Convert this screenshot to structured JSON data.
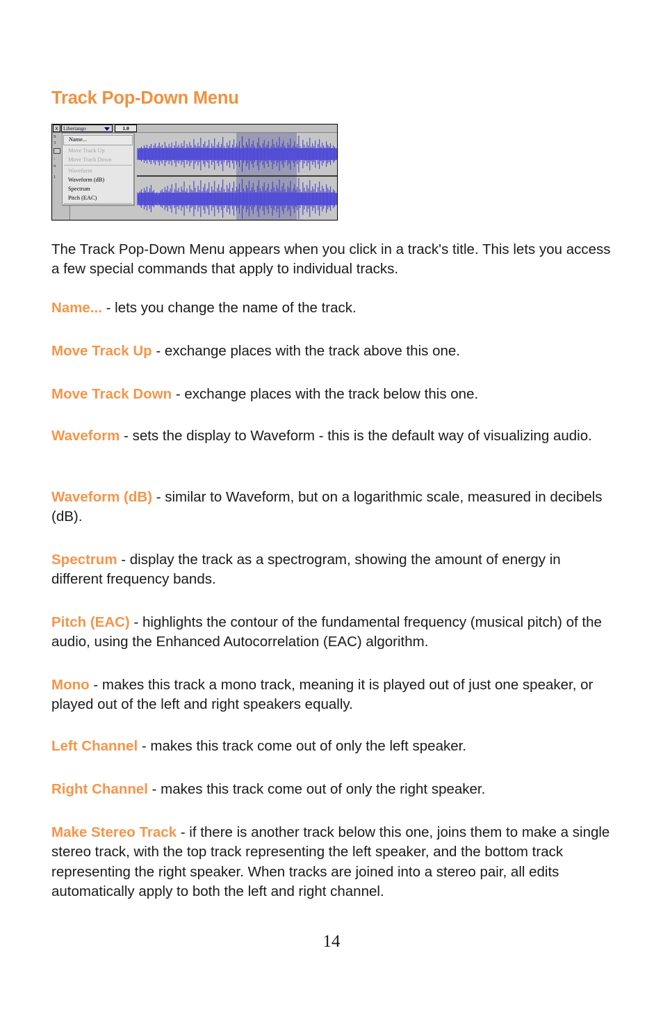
{
  "document": {
    "heading": "Track Pop-Down Menu",
    "page_number": "14",
    "accent_color": "#f0913f",
    "term_color": "#f5954a",
    "text_color": "#1a1a1a"
  },
  "figure": {
    "titlebar": {
      "close_label": "x",
      "track_name": "Libertango",
      "dropdown_icon": "chevron-down-icon",
      "version_label": "1.0"
    },
    "panel_labels": [
      "S",
      "3",
      "M",
      "-",
      "n",
      "1"
    ],
    "waveform": {
      "wave_color": "#3a33cc",
      "wave_color_light": "#6f6ae0",
      "background_color": "#c6c6c6",
      "selection_color": "#9a9ab4",
      "track_count": 2
    },
    "menu": {
      "items": [
        {
          "label": "Name...",
          "enabled": true,
          "framed": true,
          "separator_after": false
        },
        {
          "label": "Move Track Up",
          "enabled": false,
          "framed": false,
          "separator_after": false
        },
        {
          "label": "Move Track Down",
          "enabled": false,
          "framed": false,
          "separator_after": true
        },
        {
          "label": "Waveform",
          "enabled": false,
          "framed": false,
          "separator_after": false
        },
        {
          "label": "Waveform (dB)",
          "enabled": true,
          "framed": false,
          "separator_after": false
        },
        {
          "label": "Spectrum",
          "enabled": true,
          "framed": false,
          "separator_after": false
        },
        {
          "label": "Pitch (EAC)",
          "enabled": true,
          "framed": false,
          "separator_after": true
        }
      ]
    }
  },
  "content": {
    "intro": "The Track Pop-Down Menu appears when you click in a track's title. This lets you access a few special commands that apply to individual tracks.",
    "entries": [
      {
        "term": "Name...",
        "description": " - lets you change the name of the track."
      },
      {
        "term": "Move Track Up",
        "description": " - exchange places with the track above this one."
      },
      {
        "term": "Move Track Down",
        "description": " - exchange places with the track below this one."
      },
      {
        "term": "Waveform",
        "description": " - sets the display to Waveform - this is the default way of visualizing audio."
      },
      {
        "term": "Waveform (dB)",
        "description": " - similar to Waveform, but on a logarithmic scale, measured in decibels (dB)."
      },
      {
        "term": "Spectrum",
        "description": " - display the track as a spectrogram, showing the amount of energy in different frequency bands."
      },
      {
        "term": "Pitch (EAC)",
        "description": " - highlights the contour of the fundamental frequency (musical pitch) of the audio, using the Enhanced Autocorrelation (EAC) algorithm."
      },
      {
        "term": "Mono",
        "description": " - makes this track a mono track, meaning it is played out of just one speaker, or played out of the left and right speakers equally."
      },
      {
        "term": "Left Channel",
        "description": " - makes this track come out of only the left speaker."
      },
      {
        "term": "Right Channel",
        "description": " - makes this track come out of only the right speaker."
      },
      {
        "term": "Make Stereo Track",
        "description": " - if there is another track below this one, joins them to make a single stereo track, with the top track representing the left speaker, and the bottom track representing the right speaker. When tracks are joined into a stereo pair, all edits automatically apply to both the left and right channel."
      }
    ]
  }
}
